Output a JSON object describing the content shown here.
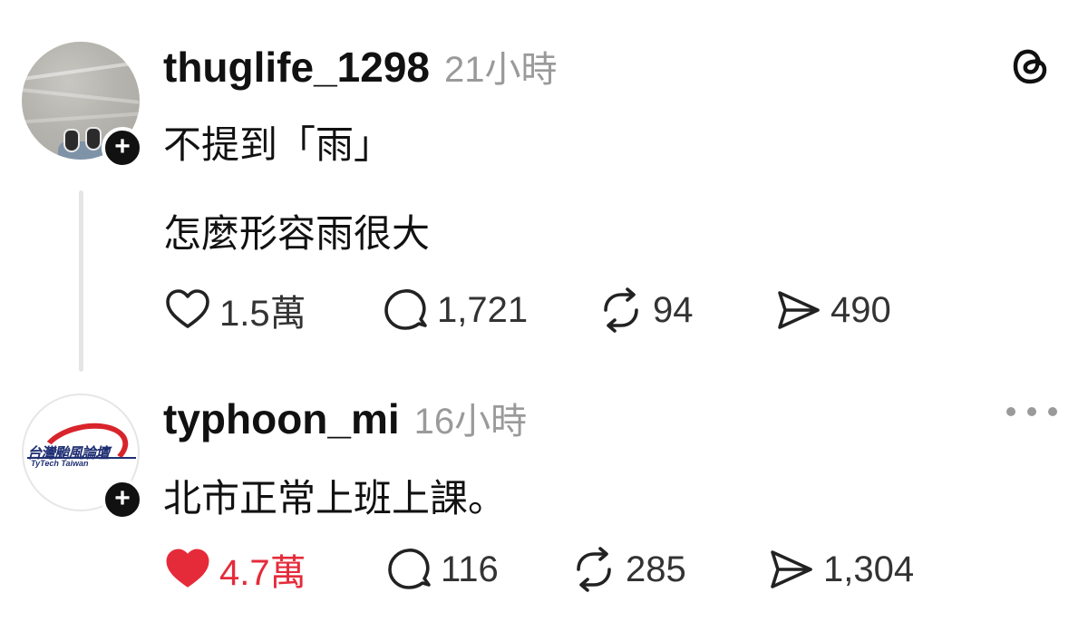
{
  "app": {
    "brand_icon": "threads-logo-icon",
    "accent_color": "#111111",
    "like_color": "#e52b3a",
    "muted_color": "#9a9a9a"
  },
  "posts": [
    {
      "username": "thuglife_1298",
      "timestamp": "21小時",
      "lines": [
        "不提到「雨」",
        "怎麼形容雨很大"
      ],
      "liked": false,
      "stats": {
        "likes": "1.5萬",
        "replies": "1,721",
        "reposts": "94",
        "shares": "490"
      }
    },
    {
      "username": "typhoon_mi",
      "timestamp": "16小時",
      "avatar_logo_text": "台灣颱風論壇",
      "avatar_logo_subtext": "TyTech Taiwan",
      "lines": [
        "北市正常上班上課。"
      ],
      "liked": true,
      "stats": {
        "likes": "4.7萬",
        "replies": "116",
        "reposts": "285",
        "shares": "1,304"
      }
    }
  ],
  "icons": {
    "like": "heart-icon",
    "reply": "comment-bubble-icon",
    "repost": "repost-arrows-icon",
    "share": "send-paper-plane-icon",
    "follow": "plus-icon",
    "more": "more-dots-icon"
  }
}
